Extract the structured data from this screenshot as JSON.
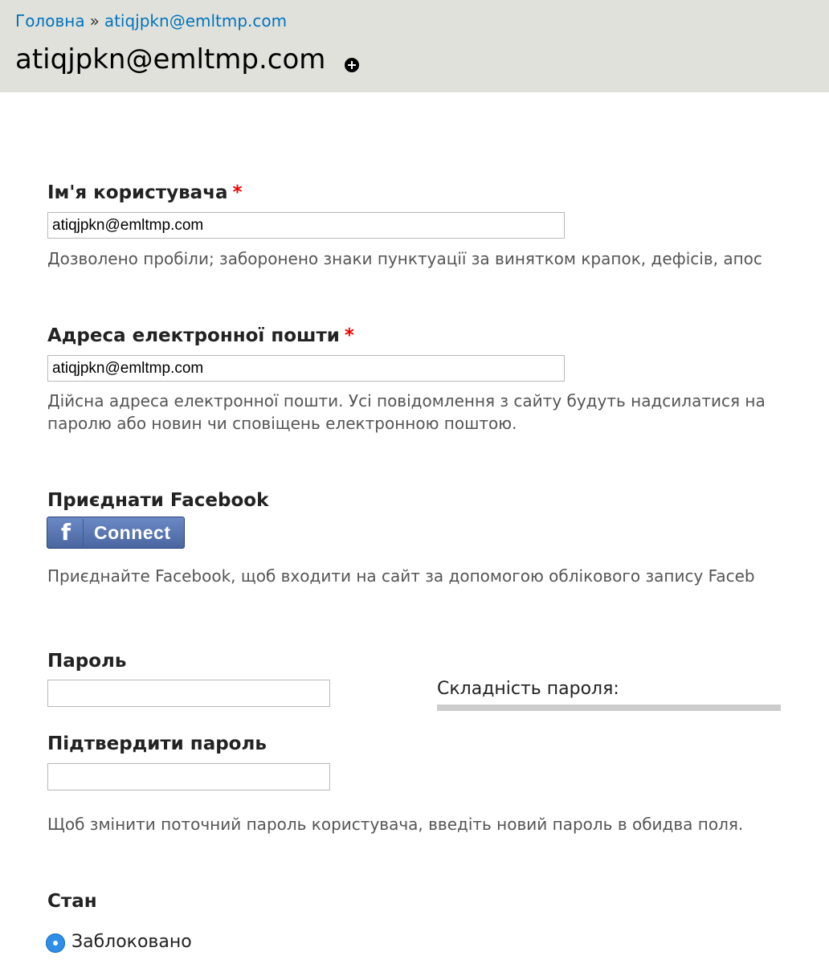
{
  "breadcrumb": {
    "home": "Головна",
    "separator": "»",
    "current": "atiqjpkn@emltmp.com"
  },
  "page_title": "atiqjpkn@emltmp.com",
  "username": {
    "label": "Ім'я користувача",
    "required_mark": "*",
    "value": "atiqjpkn@emltmp.com",
    "description": "Дозволено пробіли; заборонено знаки пунктуації за винятком крапок, дефісів, апос"
  },
  "email": {
    "label": "Адреса електронної пошти",
    "required_mark": "*",
    "value": "atiqjpkn@emltmp.com",
    "description_line1": "Дійсна адреса електронної пошти. Усі повідомлення з сайту будуть надсилатися на",
    "description_line2": "паролю або новин чи сповіщень електронною поштою."
  },
  "facebook": {
    "label": "Приєднати Facebook",
    "button_icon": "f",
    "button_label": "Connect",
    "description": "Приєднайте Facebook, щоб входити на сайт за допомогою облікового запису Faceb"
  },
  "password": {
    "label": "Пароль",
    "value": "",
    "strength_label": "Складність пароля:",
    "strength_level": 0,
    "confirm_label": "Підтвердити пароль",
    "confirm_value": "",
    "description": "Щоб змінити поточний пароль користувача, введіть новий пароль в обидва поля."
  },
  "status": {
    "label": "Стан",
    "option_selected": "Заблоковано"
  },
  "colors": {
    "header_bg": "#e1e1db",
    "link": "#0074bd",
    "required": "#ee0000",
    "radio": "#2e8ee8",
    "facebook": "#4a66a0"
  }
}
